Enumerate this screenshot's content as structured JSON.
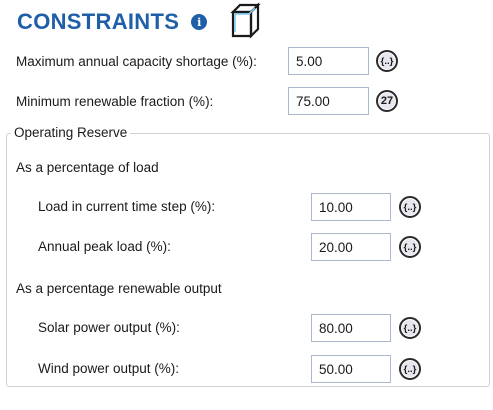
{
  "header": {
    "title": "CONSTRAINTS",
    "info_glyph": "i",
    "info_icon": "info-icon",
    "cube_icon": "cube-icon"
  },
  "fields": {
    "max_capacity_shortage": {
      "label": "Maximum annual capacity shortage (%):",
      "value": "5.00",
      "button": "{..}"
    },
    "min_renewable_fraction": {
      "label": "Minimum renewable fraction (%):",
      "value": "75.00",
      "button": "27"
    }
  },
  "operating_reserve": {
    "legend": "Operating Reserve",
    "load_section": {
      "heading": "As a percentage of load",
      "load_current_step": {
        "label": "Load in current time step (%):",
        "value": "10.00",
        "button": "{..}"
      },
      "annual_peak_load": {
        "label": "Annual peak load (%):",
        "value": "20.00",
        "button": "{..}"
      }
    },
    "renewable_section": {
      "heading": "As a percentage renewable output",
      "solar_output": {
        "label": "Solar power output (%):",
        "value": "80.00",
        "button": "{..}"
      },
      "wind_output": {
        "label": "Wind power output (%):",
        "value": "50.00",
        "button": "{..}"
      }
    }
  },
  "colors": {
    "title": "#1f5fa8",
    "input_border": "#a9b8cc",
    "group_border": "#cfcfcf"
  }
}
